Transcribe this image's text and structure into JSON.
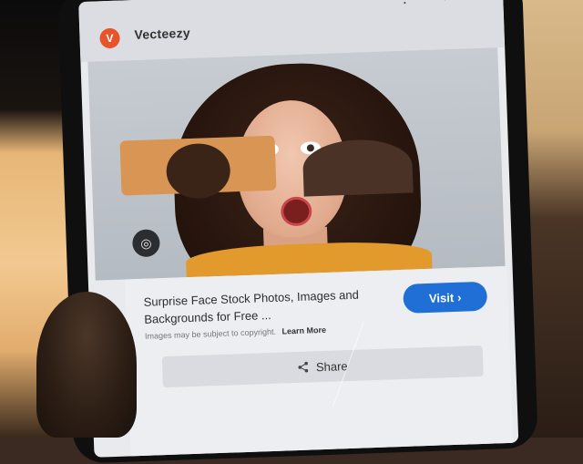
{
  "browser": {
    "site_name": "Vecteezy",
    "menu_icon": "kebab-menu-icon",
    "close_icon": "close-icon"
  },
  "image": {
    "lens_icon": "lens-icon"
  },
  "result": {
    "title": "Surprise Face Stock Photos, Images and Backgrounds for Free ...",
    "visit_label": "Visit",
    "visit_icon": "chevron-right-icon",
    "copyright_text": "Images may be subject to copyright.",
    "learn_more": "Learn More",
    "share_label": "Share",
    "share_icon": "share-icon"
  },
  "colors": {
    "visit_button": "#1f6fd6",
    "site_logo": "#e8542a",
    "shirt": "#e39a2c"
  }
}
